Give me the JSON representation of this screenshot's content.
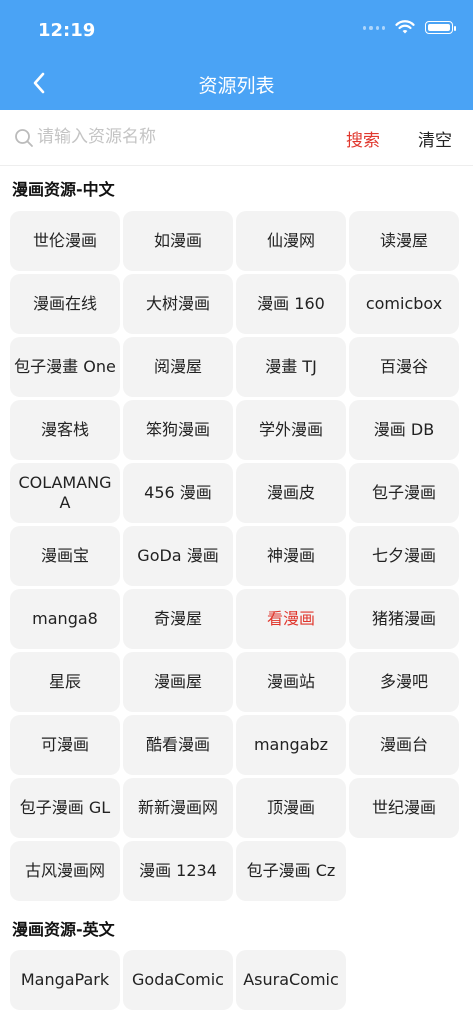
{
  "status_bar": {
    "time": "12:19"
  },
  "nav": {
    "title": "资源列表"
  },
  "search": {
    "placeholder": "请输入资源名称",
    "value": "",
    "search_label": "搜索",
    "clear_label": "清空"
  },
  "colors": {
    "nav_bg": "#4aa3f5",
    "accent_red": "#e0362c",
    "tile_bg": "#f3f3f3"
  },
  "sections": [
    {
      "title": "漫画资源-中文",
      "items": [
        {
          "label": "世伦漫画"
        },
        {
          "label": "如漫画"
        },
        {
          "label": "仙漫网"
        },
        {
          "label": "读漫屋"
        },
        {
          "label": "漫画在线"
        },
        {
          "label": "大树漫画"
        },
        {
          "label": "漫画 160"
        },
        {
          "label": "comicbox"
        },
        {
          "label": "包子漫畫 One"
        },
        {
          "label": "阅漫屋"
        },
        {
          "label": "漫畫 TJ"
        },
        {
          "label": "百漫谷"
        },
        {
          "label": "漫客栈"
        },
        {
          "label": "笨狗漫画"
        },
        {
          "label": "学外漫画"
        },
        {
          "label": "漫画 DB"
        },
        {
          "label": "COLAMANGA"
        },
        {
          "label": "456 漫画"
        },
        {
          "label": "漫画皮"
        },
        {
          "label": "包子漫画"
        },
        {
          "label": "漫画宝"
        },
        {
          "label": "GoDa 漫画"
        },
        {
          "label": "神漫画"
        },
        {
          "label": "七夕漫画"
        },
        {
          "label": "manga8"
        },
        {
          "label": "奇漫屋"
        },
        {
          "label": "看漫画",
          "selected": true
        },
        {
          "label": "猪猪漫画"
        },
        {
          "label": "星辰"
        },
        {
          "label": "漫画屋"
        },
        {
          "label": "漫画站"
        },
        {
          "label": "多漫吧"
        },
        {
          "label": "可漫画"
        },
        {
          "label": "酷看漫画"
        },
        {
          "label": "mangabz"
        },
        {
          "label": "漫画台"
        },
        {
          "label": "包子漫画 GL"
        },
        {
          "label": "新新漫画网"
        },
        {
          "label": "顶漫画"
        },
        {
          "label": "世纪漫画"
        },
        {
          "label": "古风漫画网"
        },
        {
          "label": "漫画 1234"
        },
        {
          "label": "包子漫画 Cz"
        }
      ]
    },
    {
      "title": "漫画资源-英文",
      "items": [
        {
          "label": "MangaPark"
        },
        {
          "label": "GodaComic"
        },
        {
          "label": "AsuraComic"
        }
      ]
    }
  ]
}
